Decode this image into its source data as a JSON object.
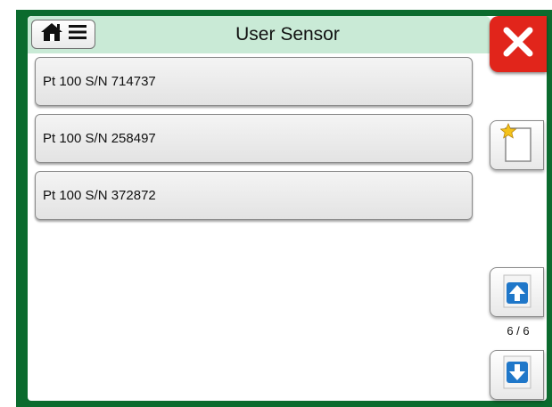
{
  "header": {
    "title": "User Sensor",
    "menu_icons": [
      "home-icon",
      "menu-icon"
    ]
  },
  "sensors": [
    {
      "label": "Pt 100 S/N 714737"
    },
    {
      "label": "Pt 100 S/N 258497"
    },
    {
      "label": "Pt 100 S/N 372872"
    }
  ],
  "side_panel": {
    "close_icon": "close-icon",
    "new_icon": "new-document-icon",
    "page_up_icon": "arrow-up-icon",
    "page_down_icon": "arrow-down-icon",
    "page_indicator": "6 / 6"
  },
  "colors": {
    "frame": "#0b6b2e",
    "titlebar": "#c9ead6",
    "close": "#e1251b",
    "arrow": "#1f77c9",
    "star": "#f4c21a"
  }
}
